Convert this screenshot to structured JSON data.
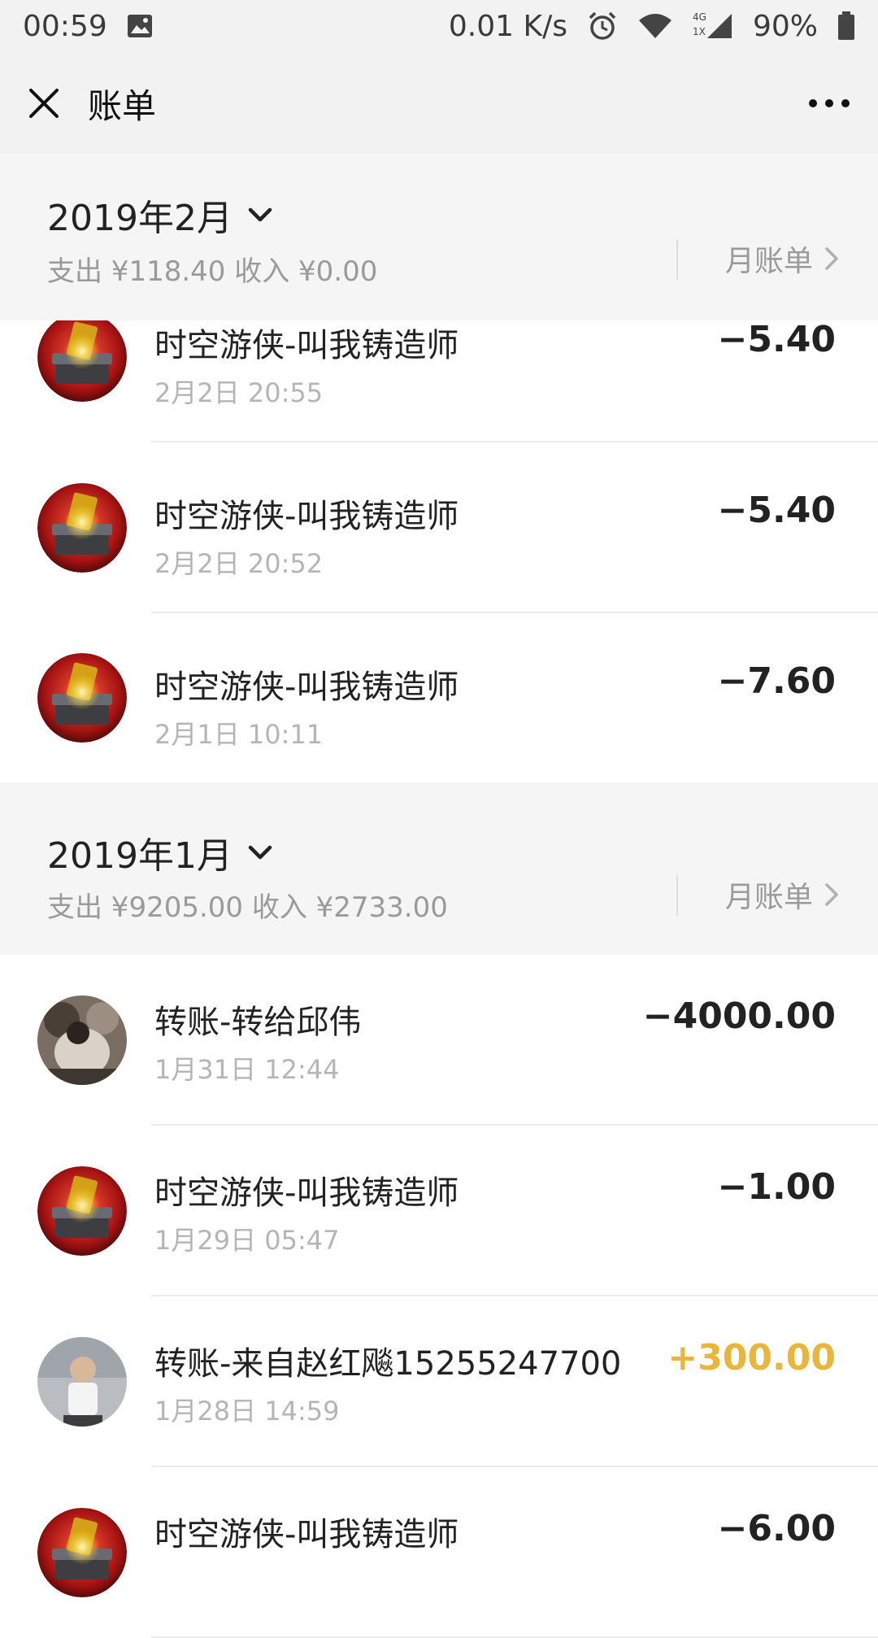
{
  "status_bar": {
    "time": "00:59",
    "net_speed": "0.01 K/s",
    "battery": "90%",
    "network_top": "4G",
    "network_bottom": "1X",
    "icons": [
      "image-icon",
      "alarm-icon",
      "wifi-icon",
      "signal-icon",
      "battery-icon"
    ]
  },
  "nav": {
    "title": "账单",
    "close_icon": "close-icon",
    "more_icon": "more-icon"
  },
  "months": [
    {
      "title": "2019年2月",
      "summary": "支出 ¥118.40 收入 ¥0.00",
      "link": "月账单"
    },
    {
      "title": "2019年1月",
      "summary": "支出 ¥9205.00 收入 ¥2733.00",
      "link": "月账单"
    }
  ],
  "transactions_feb": [
    {
      "title": "时空游侠-叫我铸造师",
      "time": "2月2日 20:55",
      "amount": "−5.40",
      "avatar": "game-avatar"
    },
    {
      "title": "时空游侠-叫我铸造师",
      "time": "2月2日 20:52",
      "amount": "−5.40",
      "avatar": "game-avatar"
    },
    {
      "title": "时空游侠-叫我铸造师",
      "time": "2月1日 10:11",
      "amount": "−7.60",
      "avatar": "game-avatar"
    }
  ],
  "transactions_jan": [
    {
      "title": "转账-转给邱伟",
      "time": "1月31日 12:44",
      "amount": "−4000.00",
      "avatar": "user-avatar-1"
    },
    {
      "title": "时空游侠-叫我铸造师",
      "time": "1月29日 05:47",
      "amount": "−1.00",
      "avatar": "game-avatar"
    },
    {
      "title": "转账-来自赵红飚15255247700",
      "time": "1月28日 14:59",
      "amount": "+300.00",
      "avatar": "user-avatar-2"
    },
    {
      "title": "时空游侠-叫我铸造师",
      "time": "",
      "amount": "−6.00",
      "avatar": "game-avatar"
    }
  ],
  "colors": {
    "income": "#e9b53a",
    "header_bg": "#f2f2f2",
    "month_bg": "#f5f5f5"
  }
}
